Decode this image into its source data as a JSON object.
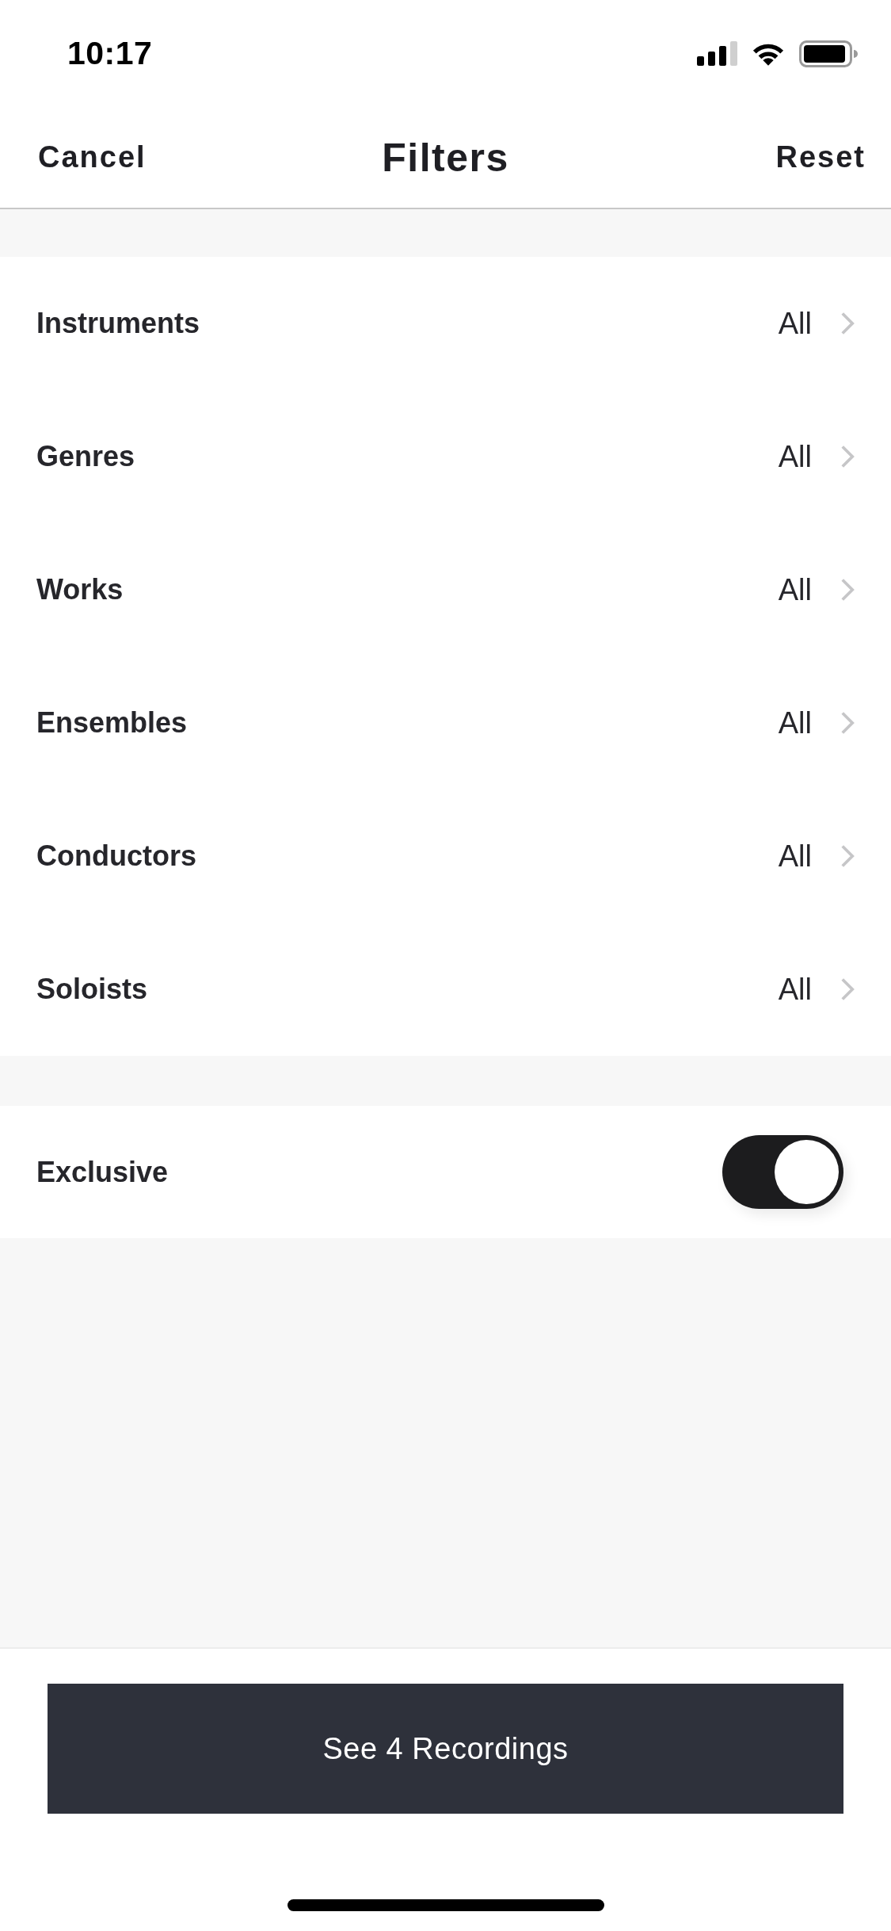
{
  "status_bar": {
    "time": "10:17"
  },
  "nav": {
    "cancel": "Cancel",
    "title": "Filters",
    "reset": "Reset"
  },
  "filters": [
    {
      "label": "Instruments",
      "value": "All"
    },
    {
      "label": "Genres",
      "value": "All"
    },
    {
      "label": "Works",
      "value": "All"
    },
    {
      "label": "Ensembles",
      "value": "All"
    },
    {
      "label": "Conductors",
      "value": "All"
    },
    {
      "label": "Soloists",
      "value": "All"
    }
  ],
  "exclusive": {
    "label": "Exclusive",
    "on": true
  },
  "primary_button": {
    "label": "See 4 Recordings"
  }
}
